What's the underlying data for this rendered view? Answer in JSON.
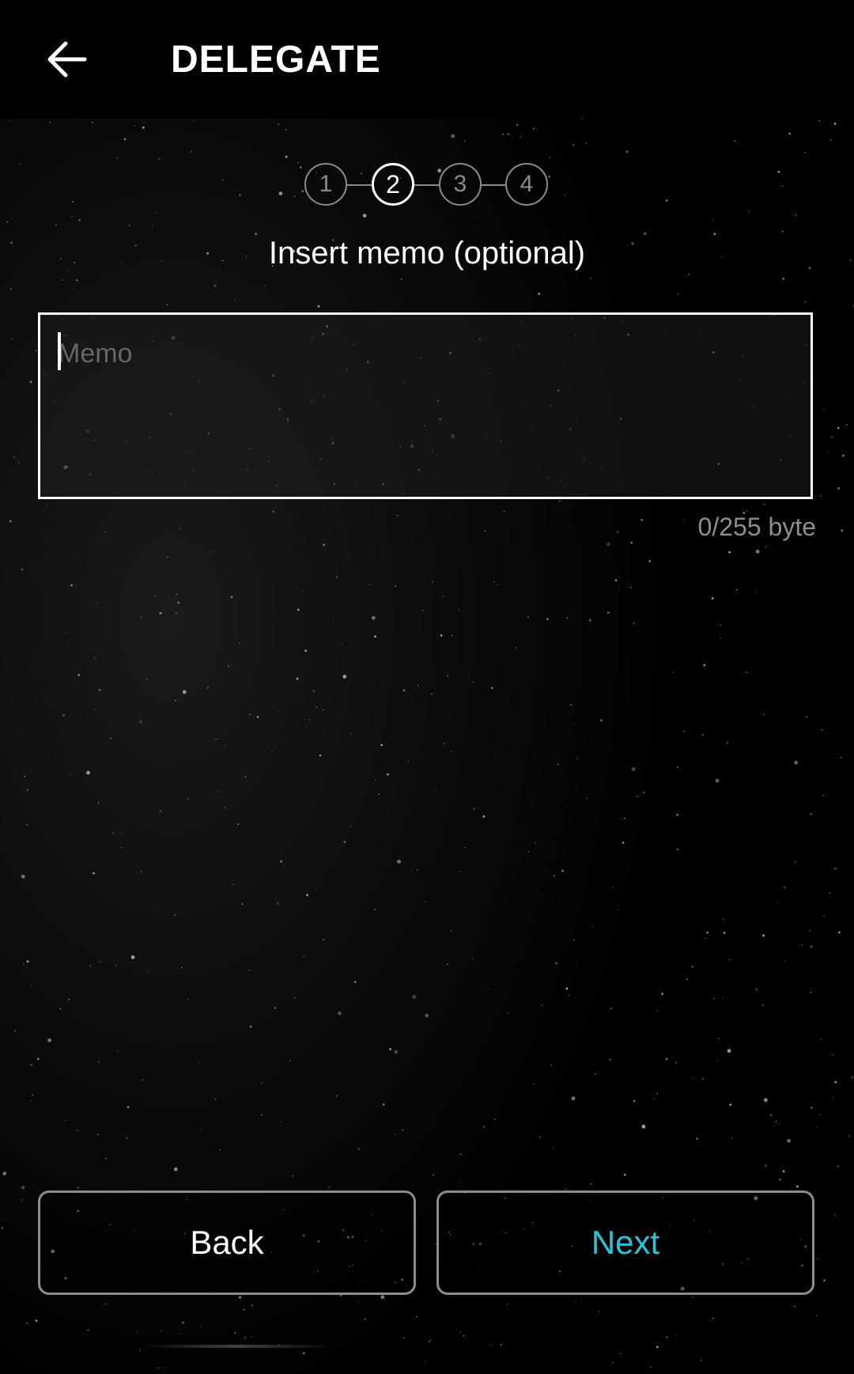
{
  "header": {
    "title": "DELEGATE"
  },
  "stepper": {
    "steps": [
      "1",
      "2",
      "3",
      "4"
    ],
    "current_step": 2
  },
  "subtitle": "Insert memo (optional)",
  "memo": {
    "placeholder": "Memo",
    "value": ""
  },
  "counter": "0/255 byte",
  "buttons": {
    "back_label": "Back",
    "next_label": "Next"
  },
  "colors": {
    "background": "#000000",
    "accent": "#28c5d6",
    "border_muted": "#8c8c8c"
  },
  "icons": {
    "back": "arrow-left-icon"
  }
}
